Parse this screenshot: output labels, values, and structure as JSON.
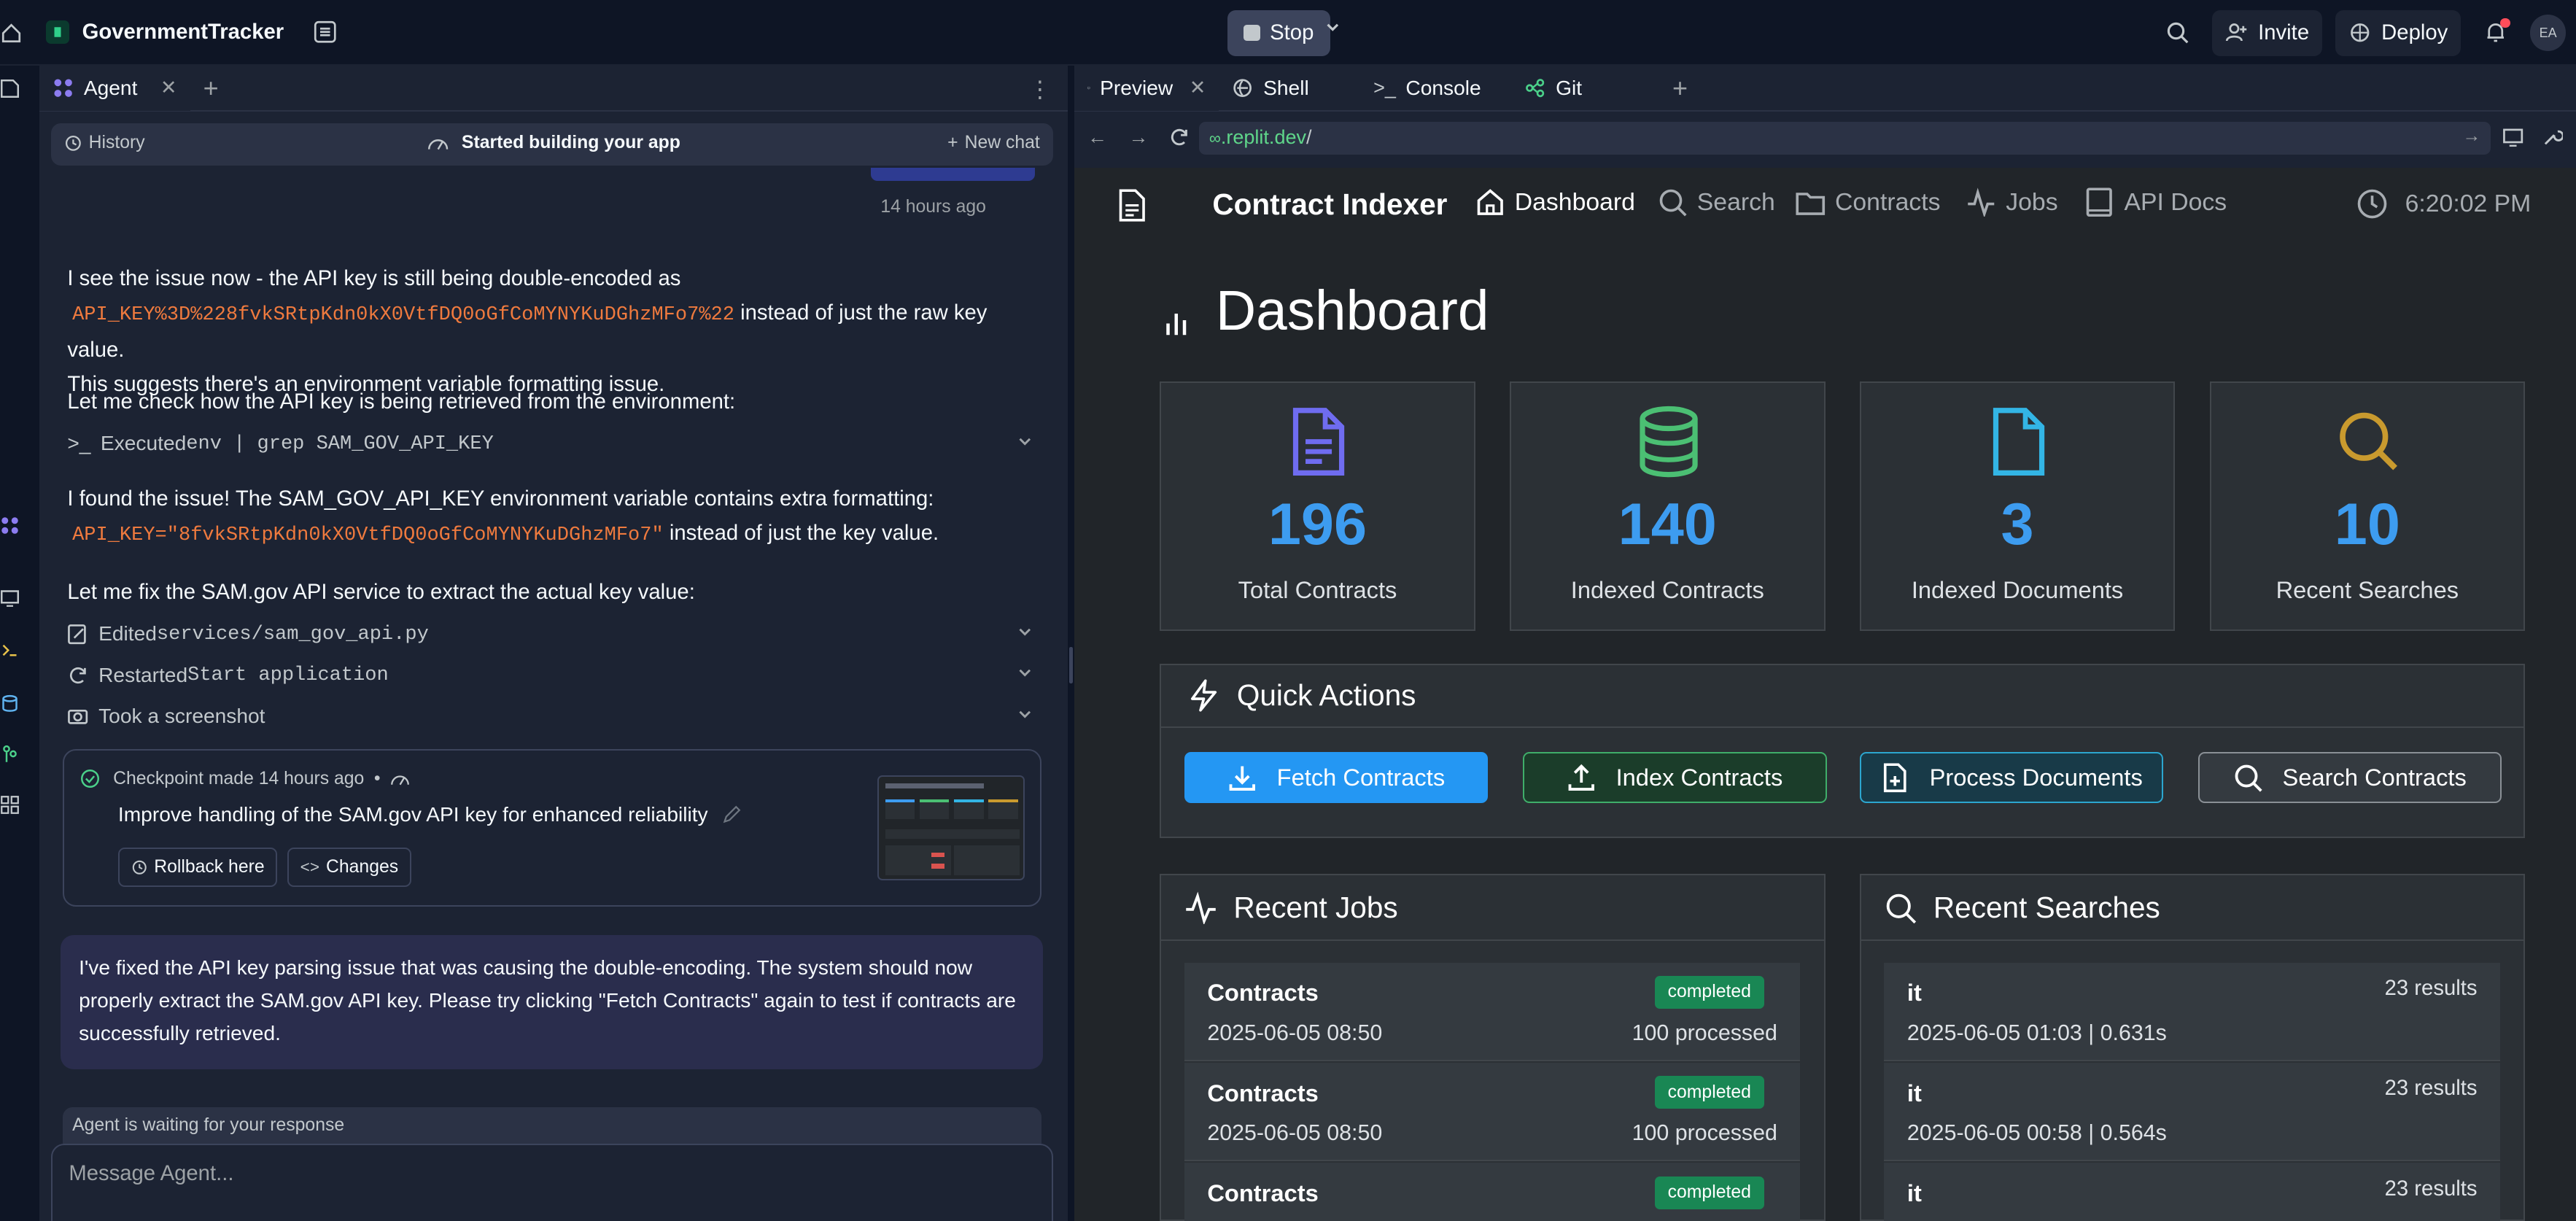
{
  "topbar": {
    "app_name": "GovernmentTracker",
    "stop_label": "Stop",
    "invite_label": "Invite",
    "deploy_label": "Deploy",
    "avatar_initials": "EA"
  },
  "agent_panel": {
    "tab_label": "Agent",
    "history_label": "History",
    "status_label": "Started building your app",
    "new_chat_label": "New chat",
    "timestamp": "14 hours ago",
    "messages": {
      "m1_line1": "I see the issue now - the API key is still being double-encoded as",
      "m1_code": "API_KEY%3D%228fvkSRtpKdn0kX0VtfDQ0oGfCoMYNYKuDGhzMFo7%22",
      "m1_after": " instead of just the raw key value.",
      "m1_line3": "This suggests there's an environment variable formatting issue.",
      "m2": "Let me check how the API key is being retrieved from the environment:",
      "m3_line1": "I found the issue! The SAM_GOV_API_KEY environment variable contains extra formatting:",
      "m3_code": "API_KEY=\"8fvkSRtpKdn0kX0VtfDQ0oGfCoMYNYKuDGhzMFo7\"",
      "m3_after": " instead of just the key value.",
      "m4": "Let me fix the SAM.gov API service to extract the actual key value:"
    },
    "actions": {
      "executed_prefix": "Executed ",
      "executed_cmd": "env | grep SAM_GOV_API_KEY",
      "edited_prefix": "Edited ",
      "edited_file": "services/sam_gov_api.py",
      "restarted_prefix": "Restarted ",
      "restarted_target": "Start application",
      "screenshot": "Took a screenshot"
    },
    "checkpoint": {
      "meta": "Checkpoint made 14 hours ago",
      "dot": "•",
      "title": "Improve handling of the SAM.gov API key for enhanced reliability",
      "rollback_label": "Rollback here",
      "changes_label": "Changes"
    },
    "final_message": "I've fixed the API key parsing issue that was causing the double-encoding. The system should now properly extract the SAM.gov API key. Please try clicking \"Fetch Contracts\" again to test if contracts are successfully retrieved.",
    "waiting_label": "Agent is waiting for your response",
    "input_placeholder": "Message Agent..."
  },
  "right_panel": {
    "tabs": [
      "Preview",
      "Shell",
      "Console",
      "Git"
    ],
    "url_domain": ".replit.dev",
    "url_path": "/"
  },
  "app": {
    "brand": "Contract Indexer",
    "nav": [
      "Dashboard",
      "Search",
      "Contracts",
      "Jobs",
      "API Docs"
    ],
    "clock": "6:20:02 PM",
    "page_title": "Dashboard",
    "stats": [
      {
        "value": "196",
        "label": "Total Contracts",
        "color": "#6f6cf0",
        "icon": "document-icon"
      },
      {
        "value": "140",
        "label": "Indexed Contracts",
        "color": "#4bbf73",
        "icon": "database-icon"
      },
      {
        "value": "3",
        "label": "Indexed Documents",
        "color": "#33b5e5",
        "icon": "file-icon"
      },
      {
        "value": "10",
        "label": "Recent Searches",
        "color": "#c99a2e",
        "icon": "search-icon"
      }
    ],
    "quick_actions": {
      "title": "Quick Actions",
      "buttons": [
        "Fetch Contracts",
        "Index Contracts",
        "Process Documents",
        "Search Contracts"
      ]
    },
    "recent_jobs": {
      "title": "Recent Jobs",
      "rows": [
        {
          "name": "Contracts",
          "date": "2025-06-05 08:50",
          "status": "completed",
          "processed": "100 processed"
        },
        {
          "name": "Contracts",
          "date": "2025-06-05 08:50",
          "status": "completed",
          "processed": "100 processed"
        },
        {
          "name": "Contracts",
          "date": "",
          "status": "completed",
          "processed": ""
        }
      ]
    },
    "recent_searches": {
      "title": "Recent Searches",
      "rows": [
        {
          "query": "it",
          "meta": "2025-06-05 01:03 | 0.631s",
          "results": "23 results"
        },
        {
          "query": "it",
          "meta": "2025-06-05 00:58 | 0.564s",
          "results": "23 results"
        },
        {
          "query": "it",
          "meta": "",
          "results": "23 results"
        }
      ]
    }
  }
}
